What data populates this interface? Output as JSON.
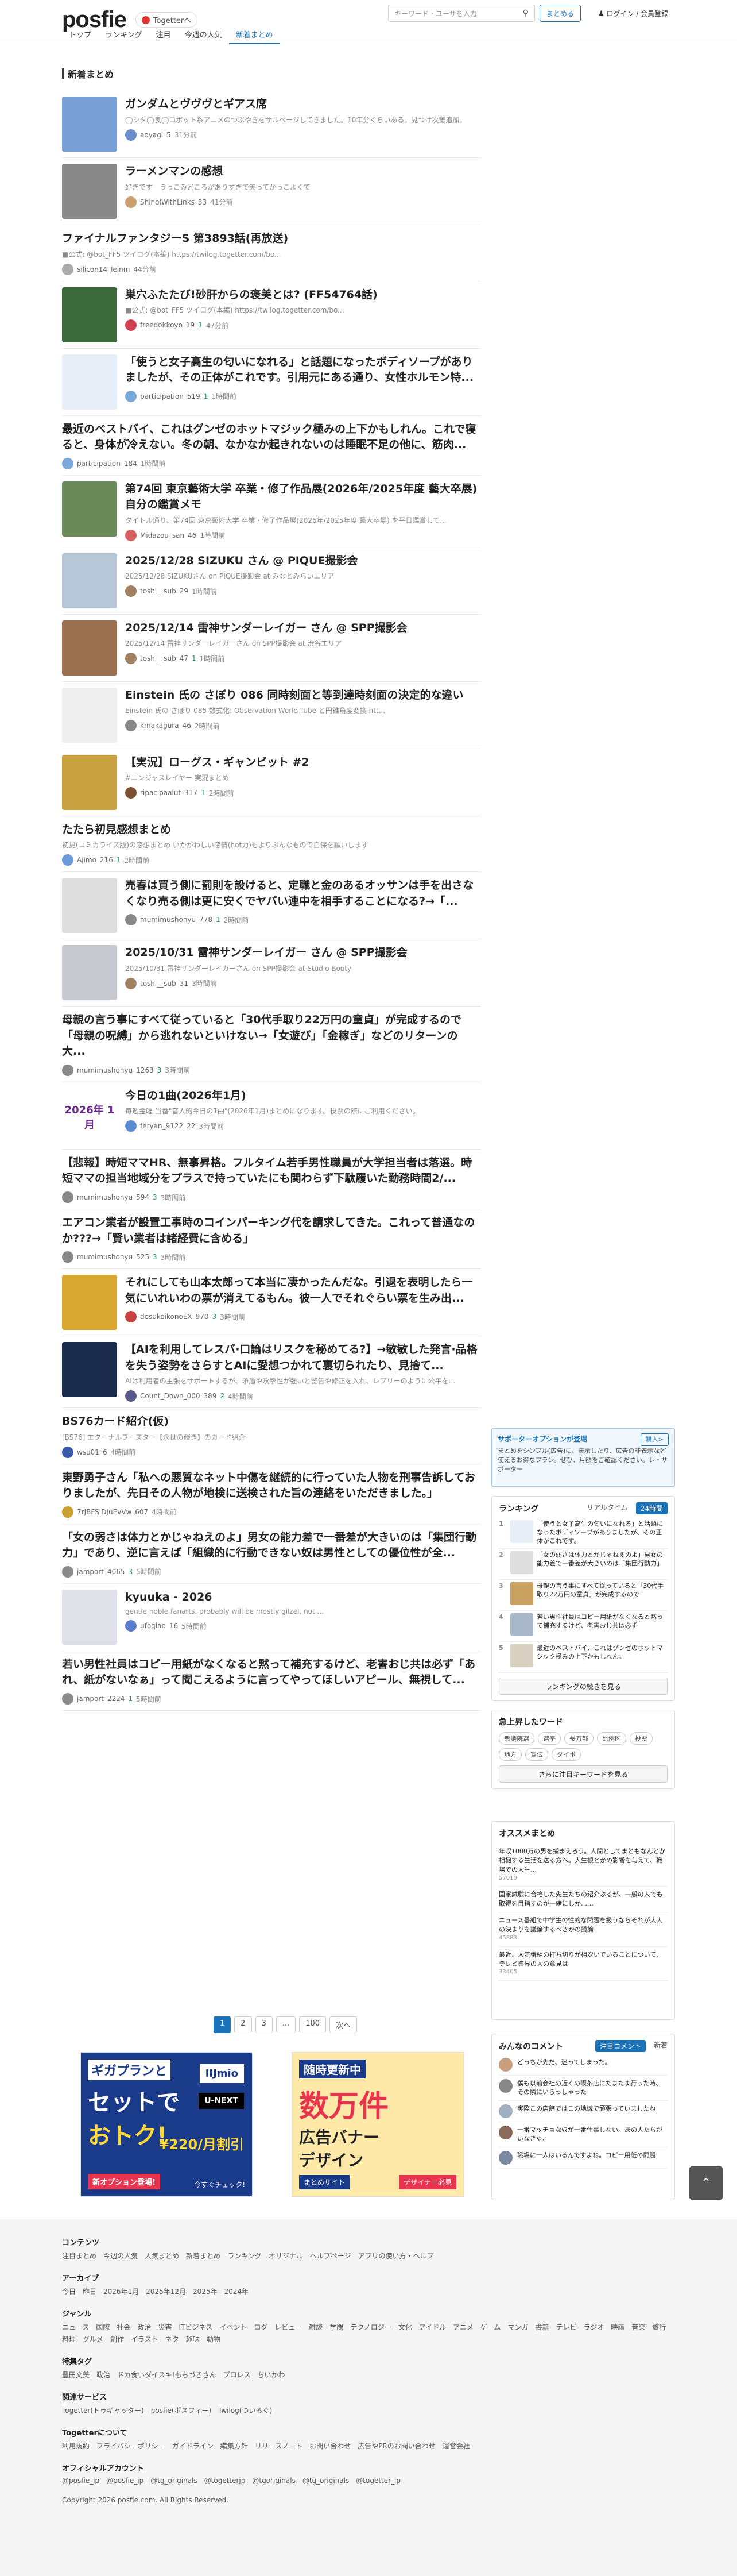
{
  "header": {
    "logo": "posfie",
    "togetter_label": "Togetterへ",
    "search_placeholder": "キーワード・ユーザを入力",
    "summary_button": "まとめる",
    "login_button": "ログイン / 会員登録",
    "nav": [
      "トップ",
      "ランキング",
      "注目",
      "今週の人気",
      "新着まとめ"
    ]
  },
  "main": {
    "section_title": "新着まとめ",
    "items": [
      {
        "title": "ガンダムとヴヴヴとギアス席",
        "desc": "◯シタ◯良◯ロボット系アニメのつぶやきをサルベージしてきました。10年分くらいある。見つけ次第追加。",
        "user": "aoyagi",
        "views": "5",
        "favs": "",
        "rt": "",
        "time": "31分前",
        "thumb": "#7aa0d8",
        "av": "#6b8fc8"
      },
      {
        "title": "ラーメンマンの感想",
        "desc": "好きです　うっこみどころがありすぎて笑ってかっこよくて",
        "user": "ShinoiWithLinks",
        "views": "33",
        "favs": "",
        "rt": "",
        "time": "41分前",
        "thumb": "#888",
        "av": "#c8a070"
      },
      {
        "title": "ファイナルファンタジーS 第3893話(再放送)",
        "desc": "■公式: @bot_FF5 ツイログ(本編) https://twilog.togetter.com/bo...",
        "user": "silicon14_leinm",
        "views": "",
        "favs": "",
        "rt": "",
        "time": "44分前",
        "thumb": "",
        "av": "#aaa"
      },
      {
        "title": "巣穴ふたたび!砂肝からの褒美とは? (FF54764話)",
        "desc": "■公式: @bot_FF5 ツイログ(本編) https://twilog.togetter.com/bo...",
        "user": "freedokkoyo",
        "views": "19",
        "favs": "",
        "rt": "1",
        "time": "47分前",
        "thumb": "#3a6a3a",
        "av": "#d04050"
      },
      {
        "title": "「使うと女子高生の匂いになれる」と話題になったボディソープがありましたが、その正体がこれです。引用元にある通り、女性ホルモン特...",
        "desc": "",
        "user": "participation",
        "views": "519",
        "favs": "",
        "rt": "1",
        "time": "1時間前",
        "thumb": "#e8eef8",
        "av": "#7aa8d8"
      },
      {
        "title": "最近のベストバイ、これはグンゼのホットマジック極みの上下かもしれん。これで寝ると、身体が冷えない。冬の朝、なかなか起きれないのは睡眠不足の他に、筋肉...",
        "desc": "",
        "user": "participation",
        "views": "184",
        "favs": "",
        "rt": "",
        "time": "1時間前",
        "thumb": "",
        "av": "#7aa8d8"
      },
      {
        "title": "第74回 東京藝術大学 卒業・修了作品展(2026年/2025年度 藝大卒展) 自分の鑑賞メモ",
        "desc": "タイトル通り、第74回 東京藝術大学 卒業・修了作品展(2026年/2025年度 藝大卒展) を平日鑑賞して...",
        "user": "Midazou_san",
        "views": "46",
        "favs": "",
        "rt": "",
        "time": "1時間前",
        "thumb": "#6a8a5a",
        "av": "#d86060"
      },
      {
        "title": "2025/12/28 SIZUKU さん @ PIQUE撮影会",
        "desc": "2025/12/28 SIZUKUさん on PIQUE撮影会 at みなとみらいエリア",
        "user": "toshi__sub",
        "views": "29",
        "favs": "",
        "rt": "",
        "time": "1時間前",
        "thumb": "#b8c8d8",
        "av": "#a08060"
      },
      {
        "title": "2025/12/14 雷神サンダーレイガー さん @ SPP撮影会",
        "desc": "2025/12/14 雷神サンダーレイガーさん on SPP撮影会 at 渋谷エリア",
        "user": "toshi__sub",
        "views": "47",
        "favs": "",
        "rt": "1",
        "time": "1時間前",
        "thumb": "#9a7050",
        "av": "#a08060"
      },
      {
        "title": "Einstein 氏の さぼり 086 同時刻面と等到達時刻面の決定的な違い",
        "desc": "Einstein 氏の さぼり 085 数式化: Observation World Tube と円錐角度変換 htt...",
        "user": "kmakagura",
        "views": "46",
        "favs": "",
        "rt": "",
        "time": "2時間前",
        "thumb": "#eee",
        "av": "#888"
      },
      {
        "title": "【実況】ローグス・ギャンビット #2",
        "desc": "#ニンジャスレイヤー 実況まとめ",
        "user": "ripacipaalut",
        "views": "317",
        "favs": "",
        "rt": "1",
        "time": "2時間前",
        "thumb": "#c8a040",
        "av": "#7a5030"
      },
      {
        "title": "たたら初見感想まとめ",
        "desc": "初見(コミカライズ版)の感想まとめ いかがわしい感情(hot力)もよりぶんなもので自保を願いします",
        "user": "Ajimo",
        "views": "216",
        "favs": "",
        "rt": "1",
        "time": "2時間前",
        "thumb": "",
        "av": "#6a9ad8"
      },
      {
        "title": "売春は買う側に罰則を設けると、定職と金のあるオッサンは手を出さなくなり売る側は更に安くでヤバい連中を相手することになる?→「...",
        "desc": "",
        "user": "mumimushonyu",
        "views": "778",
        "favs": "",
        "rt": "1",
        "time": "2時間前",
        "thumb": "#ddd",
        "av": "#888"
      },
      {
        "title": "2025/10/31 雷神サンダーレイガー さん @ SPP撮影会",
        "desc": "2025/10/31 雷神サンダーレイガーさん on SPP撮影会 at Studio Booty",
        "user": "toshi__sub",
        "views": "31",
        "favs": "",
        "rt": "",
        "time": "3時間前",
        "thumb": "#c8c8d0",
        "av": "#a08060"
      },
      {
        "title": "母親の言う事にすべて従っていると「30代手取り22万円の童貞」が完成するので「母親の呪縛」から逃れないといけない→「女遊び」「金稼ぎ」などのリターンの大...",
        "desc": "",
        "user": "mumimushonyu",
        "views": "1263",
        "favs": "",
        "rt": "3",
        "time": "3時間前",
        "thumb": "",
        "av": "#888"
      },
      {
        "title": "今日の1曲(2026年1月)",
        "desc": "毎週金曜 当番\"音人的今日の1曲\"(2026年1月)まとめになります。投票の際にご利用ください。",
        "user": "feryan_9122",
        "views": "22",
        "favs": "",
        "rt": "",
        "time": "3時間前",
        "thumb": "#fff",
        "av": "#5a8ad0",
        "thumbtext": "2026年 1月"
      },
      {
        "title": "【悲報】時短ママHR、無事昇格。フルタイム若手男性職員が大学担当者は落選。時短ママの担当地域分をプラスで持っていたにも関わらず下駄履いた勤務時間2/...",
        "desc": "",
        "user": "mumimushonyu",
        "views": "594",
        "favs": "",
        "rt": "3",
        "time": "3時間前",
        "thumb": "",
        "av": "#888"
      },
      {
        "title": "エアコン業者が設置工事時のコインパーキング代を請求してきた。これって普通なのか???→「賢い業者は諸経費に含める」",
        "desc": "",
        "user": "mumimushonyu",
        "views": "525",
        "favs": "",
        "rt": "3",
        "time": "3時間前",
        "thumb": "",
        "av": "#888"
      },
      {
        "title": "それにしても山本太郎って本当に凄かったんだな。引退を表明したら一気にいれいわの票が消えてるもん。彼一人でそれぐらい票を生み出...",
        "desc": "",
        "user": "dosukoikonoEX",
        "views": "970",
        "favs": "",
        "rt": "3",
        "time": "3時間前",
        "thumb": "#d8a830",
        "av": "#c84040"
      },
      {
        "title": "【AIを利用してレスバ·口論はリスクを秘めてる?】→敏敏した発言·品格を失う姿勢をさらすとAIに愛想つかれて裏切られたり、見捨て...",
        "desc": "AIは利用者の主張をサポートするが、矛盾や攻撃性が強いと警告や修正を入れ、レプリーのように公平を...",
        "user": "Count_Down_000",
        "views": "389",
        "favs": "",
        "rt": "2",
        "time": "4時間前",
        "thumb": "#1a2a4a",
        "av": "#5a5a8a"
      },
      {
        "title": "BS76カード紹介(仮)",
        "desc": "[BS76] エターナルブースター【永世の輝き】のカード紹介",
        "user": "wsu01",
        "views": "6",
        "favs": "",
        "rt": "",
        "time": "4時間前",
        "thumb": "",
        "av": "#3a5aa8"
      },
      {
        "title": "東野勇子さん「私への悪質なネット中傷を継続的に行っていた人物を刑事告訴しておりましたが、先日その人物が地検に送検された旨の連絡をいただきました。」",
        "desc": "",
        "user": "7rJBFSIDJuEvVw",
        "views": "607",
        "favs": "",
        "rt": "",
        "time": "4時間前",
        "thumb": "",
        "av": "#c8a030"
      },
      {
        "title": "「女の弱さは体力とかじゃねえのよ」男女の能力差で一番差が大きいのは「集団行動力」であり、逆に言えば「組織的に行動できない奴は男性としての優位性が全...",
        "desc": "",
        "user": "jamport",
        "views": "4065",
        "favs": "",
        "rt": "3",
        "time": "5時間前",
        "thumb": "",
        "av": "#8a8a8a"
      },
      {
        "title": "kyuuka - 2026",
        "desc": "gentle noble fanarts. probably will be mostly gilzel. not ...",
        "user": "ufoqiao",
        "views": "16",
        "favs": "",
        "rt": "",
        "time": "5時間前",
        "thumb": "#e0e0e8",
        "av": "#5a7ad0"
      },
      {
        "title": "若い男性社員はコピー用紙がなくなると黙って補充するけど、老害おじ共は必ず「あれ、紙がないなぁ」って聞こえるように言ってやってほしいアピール、無視して...",
        "desc": "",
        "user": "jamport",
        "views": "2224",
        "favs": "",
        "rt": "1",
        "time": "5時間前",
        "thumb": "",
        "av": "#8a8a8a"
      }
    ],
    "pager": [
      "1",
      "2",
      "3",
      "...",
      "100",
      "次へ"
    ],
    "ads": [
      {
        "text1": "ギガプランと",
        "text2": "セットで",
        "text3": "おトク!",
        "text4": "新オプション登場!",
        "text5": "今すぐチェック!",
        "brand": "IIJmio",
        "brand2": "U-NEXT",
        "price": "¥220/月割引"
      },
      {
        "text1": "随時更新中",
        "text2": "数万件",
        "text3": "広告バナー",
        "text4": "デザイン",
        "text5": "デザイナー必見",
        "brand": "まとめサイト"
      }
    ]
  },
  "sidebar": {
    "sponsor": {
      "title": "サポーターオプションが登場",
      "button": "購入>",
      "text": "まとめをシンプル(広告)に、表示したり、広告の非表示など使えるお得なプラン。ぜひ、月額をご確認ください。レ・サポーター"
    },
    "ranking": {
      "title": "ランキング",
      "tabs": [
        "リアルタイム",
        "24時間"
      ],
      "items": [
        {
          "rank": "1",
          "text": "「使うと女子高生の匂いになれる」と話題になったボディソープがありましたが、その正体がこれです。",
          "color": "#e8eef8"
        },
        {
          "rank": "2",
          "text": "「女の弱さは体力とかじゃねえのよ」男女の能力差で一番差が大きいのは「集団行動力」",
          "color": "#ddd"
        },
        {
          "rank": "3",
          "text": "母親の言う事にすべて従っていると「30代手取り22万円の童貞」が完成するので",
          "color": "#c8a060"
        },
        {
          "rank": "4",
          "text": "若い男性社員はコピー用紙がなくなると黙って補充するけど、老害おじ共は必ず",
          "color": "#a8b8c8"
        },
        {
          "rank": "5",
          "text": "最近のベストバイ、これはグンゼのホットマジック極みの上下かもしれん。",
          "color": "#d8d0c0"
        }
      ],
      "more": "ランキングの続きを見る"
    },
    "keywords": {
      "title": "急上昇したワード",
      "chips": [
        "衆議院選",
        "選挙",
        "長万部",
        "比例区",
        "投票",
        "地方",
        "宣伝",
        "タイポ"
      ],
      "more": "さらに注目キーワードを見る"
    },
    "osusume": {
      "title": "オススメまとめ",
      "items": [
        {
          "text": "年収1000万の男を捕まえろう。人間としてまともなんとか相槌する生活を送る方へ。人生観とかの影響を与えて、職場での人生…",
          "meta": "57010"
        },
        {
          "text": "国家試験に合格した先生たちの紹介ぶるが、一般の人でも取得を目指すのが一緒にしか……",
          "meta": ""
        },
        {
          "text": "ニュース番組で中学生の性的な問題を扱うならそれが大人の決まりを議論するべきかの議論",
          "meta": "45883"
        },
        {
          "text": "最近、人気番組の打ち切りが相次いでいることについて、テレビ業界の人の意見は",
          "meta": "33405"
        }
      ]
    },
    "comments": {
      "title": "みんなのコメント",
      "tabs": [
        "注目コメント",
        "新着"
      ],
      "items": [
        {
          "text": "どっちが先だ、迷ってしまった。",
          "color": "#c8a080"
        },
        {
          "text": "僕も以前会社の近くの喫茶店にたまたま行った時、その隣にいらっしゃった",
          "color": "#888"
        },
        {
          "text": "実際この店舗ではこの地域で頑張っていましたね",
          "color": "#a0b0c0"
        },
        {
          "text": "一番マッチョな奴が一番仕事しない。あの人たちがいなきゃ、",
          "color": "#8a6a5a"
        },
        {
          "text": "職場に一人はいるんですよね。コピー用紙の問題",
          "color": "#7a8aa0"
        }
      ]
    }
  },
  "footer": {
    "sections": [
      {
        "title": "コンテンツ",
        "links": [
          "注目まとめ",
          "今週の人気",
          "人気まとめ",
          "新着まとめ",
          "ランキング",
          "オリジナル",
          "ヘルプページ",
          "アプリの使い方・ヘルプ"
        ]
      },
      {
        "title": "アーカイブ",
        "links": [
          "今日",
          "昨日",
          "2026年1月",
          "2025年12月",
          "2025年",
          "2024年"
        ]
      },
      {
        "title": "ジャンル",
        "links": [
          "ニュース",
          "国際",
          "社会",
          "政治",
          "災害",
          "ITビジネス",
          "イベント",
          "ログ",
          "レビュー",
          "雑談",
          "学問",
          "テクノロジー",
          "文化",
          "アイドル",
          "アニメ",
          "ゲーム",
          "マンガ",
          "書籍",
          "テレビ",
          "ラジオ",
          "映画",
          "音楽",
          "旅行",
          "料理",
          "グルメ",
          "創作",
          "イラスト",
          "ネタ",
          "趣味",
          "動物"
        ]
      },
      {
        "title": "特集タグ",
        "links": [
          "豊田文美",
          "政治",
          "ドカ食いダイスキ!もちづきさん",
          "プロレス",
          "ちいかわ"
        ]
      },
      {
        "title": "関連サービス",
        "links": [
          "Togetter(トゥギャッター)",
          "posfie(ポスフィー)",
          "Twilog(ついろぐ)"
        ]
      },
      {
        "title": "Togetterについて",
        "links": [
          "利用規約",
          "プライバシーポリシー",
          "ガイドライン",
          "編集方針",
          "リリースノート",
          "お問い合わせ",
          "広告やPRのお問い合わせ",
          "運営会社"
        ]
      },
      {
        "title": "オフィシャルアカウント",
        "links": [
          "@posfie_jp",
          "@posfie_jp",
          "@tg_originals",
          "@togetterjp",
          "@tgoriginals",
          "@tg_originals",
          "@togetter_jp"
        ]
      }
    ],
    "copyright": "Copyright 2026 posfie.com. All Rights Reserved."
  }
}
